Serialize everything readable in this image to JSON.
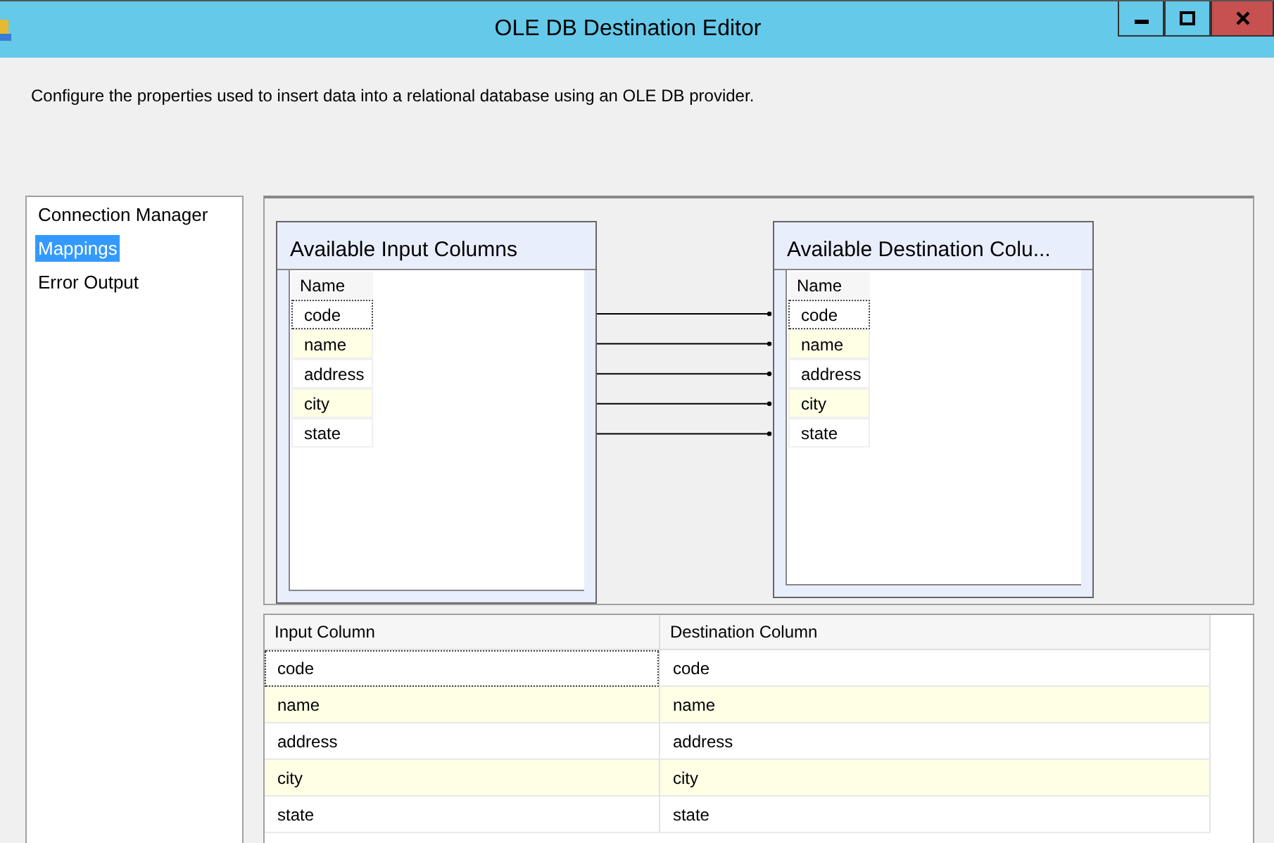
{
  "window": {
    "title": "OLE DB Destination Editor"
  },
  "description": "Configure the properties used to insert data into a relational database using an OLE DB provider.",
  "sidebar": {
    "items": [
      {
        "label": "Connection Manager",
        "selected": false
      },
      {
        "label": "Mappings",
        "selected": true
      },
      {
        "label": "Error Output",
        "selected": false
      }
    ]
  },
  "input_columns": {
    "title": "Available Input Columns",
    "header": "Name",
    "rows": [
      {
        "name": "code",
        "focused": true
      },
      {
        "name": "name",
        "focused": false
      },
      {
        "name": "address",
        "focused": false
      },
      {
        "name": "city",
        "focused": false
      },
      {
        "name": "state",
        "focused": false
      }
    ]
  },
  "destination_columns": {
    "title": "Available Destination Colu...",
    "header": "Name",
    "rows": [
      {
        "name": "code",
        "focused": true
      },
      {
        "name": "name",
        "focused": false
      },
      {
        "name": "address",
        "focused": false
      },
      {
        "name": "city",
        "focused": false
      },
      {
        "name": "state",
        "focused": false
      }
    ]
  },
  "mapping_table": {
    "columns": [
      "Input Column",
      "Destination Column"
    ],
    "rows": [
      {
        "cells": [
          "code",
          "code"
        ],
        "focused": true
      },
      {
        "cells": [
          "name",
          "name"
        ],
        "focused": false
      },
      {
        "cells": [
          "address",
          "address"
        ],
        "focused": false
      },
      {
        "cells": [
          "city",
          "city"
        ],
        "focused": false
      },
      {
        "cells": [
          "state",
          "state"
        ],
        "focused": false
      }
    ]
  }
}
